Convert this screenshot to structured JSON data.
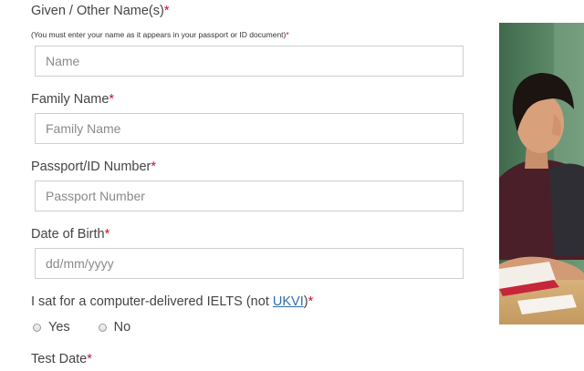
{
  "form": {
    "given_name": {
      "label": "Given / Other Name(s)",
      "required_mark": "*",
      "hint": "(You must enter your name as it appears in your passport or ID document)",
      "hint_mark": "*",
      "placeholder": "Name",
      "value": ""
    },
    "family_name": {
      "label": "Family Name",
      "required_mark": "*",
      "placeholder": "Family Name",
      "value": ""
    },
    "passport": {
      "label": "Passport/ID Number",
      "required_mark": "*",
      "placeholder": "Passport Number",
      "value": ""
    },
    "dob": {
      "label": "Date of Birth",
      "required_mark": "*",
      "placeholder": "dd/mm/yyyy",
      "value": ""
    },
    "computer_ielts": {
      "label_prefix": "I sat for a computer-delivered IELTS (not ",
      "link_text": "UKVI",
      "label_suffix": ")",
      "required_mark": "*",
      "options": [
        "Yes",
        "No"
      ],
      "selected": null
    },
    "test_date": {
      "label": "Test Date",
      "required_mark": "*"
    }
  },
  "colors": {
    "required": "#c8102e",
    "link": "#2f6fad",
    "input_border": "#cfcfcf",
    "label_text": "#444444"
  }
}
